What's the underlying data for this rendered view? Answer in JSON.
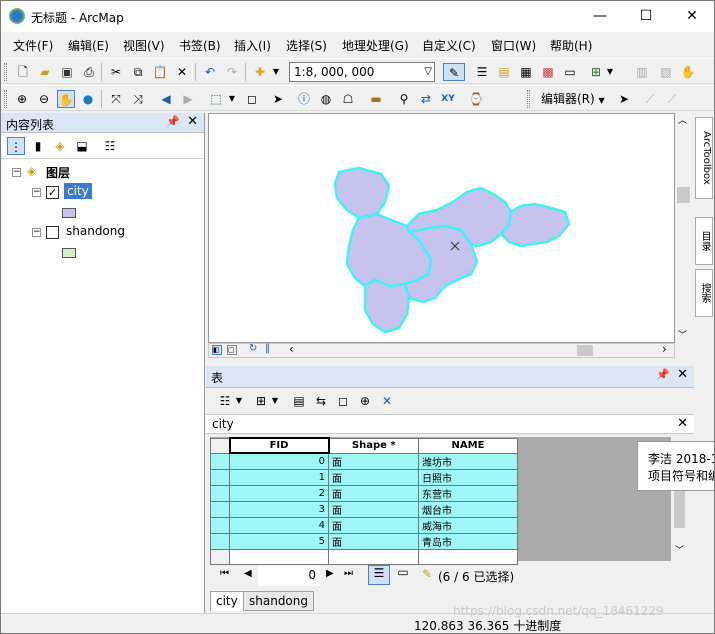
{
  "window": {
    "title": "无标题 - ArcMap",
    "minimize": "—",
    "maximize": "☐",
    "close": "✕"
  },
  "menu": [
    "文件(F)",
    "编辑(E)",
    "视图(V)",
    "书签(B)",
    "插入(I)",
    "选择(S)",
    "地理处理(G)",
    "自定义(C)",
    "窗口(W)",
    "帮助(H)"
  ],
  "toolbar": {
    "scale": "1:8, 000, 000",
    "editor_label": "编辑器(R)"
  },
  "toc": {
    "title": "内容列表",
    "root": "图层",
    "layers": [
      {
        "name": "city",
        "checked": true,
        "selected": true,
        "swatch": "#c8c3ee"
      },
      {
        "name": "shandong",
        "checked": false,
        "selected": false,
        "swatch": "#d6efc6"
      }
    ]
  },
  "dock_tabs": [
    "ArcToolbox",
    "目录",
    "搜索"
  ],
  "map": {
    "fill": "#c8c3ee",
    "outline": "#3ff2f4"
  },
  "table": {
    "pane_title": "表",
    "table_name": "city",
    "columns": [
      "FID",
      "Shape *",
      "NAME"
    ],
    "rows": [
      [
        "0",
        "面",
        "潍坊市"
      ],
      [
        "1",
        "面",
        "日照市"
      ],
      [
        "2",
        "面",
        "东营市"
      ],
      [
        "3",
        "面",
        "烟台市"
      ],
      [
        "4",
        "面",
        "威海市"
      ],
      [
        "5",
        "面",
        "青岛市"
      ]
    ],
    "record_position": "0",
    "selection_status": "(6 / 6 已选择)",
    "tabs": [
      "city",
      "shandong"
    ]
  },
  "tooltip": {
    "line1": "李洁 2018-1",
    "line2": "项目符号和编"
  },
  "status": {
    "coords": "120.863  36.365 十进制度",
    "watermark": "https://blog.csdn.net/qq_18461229"
  }
}
